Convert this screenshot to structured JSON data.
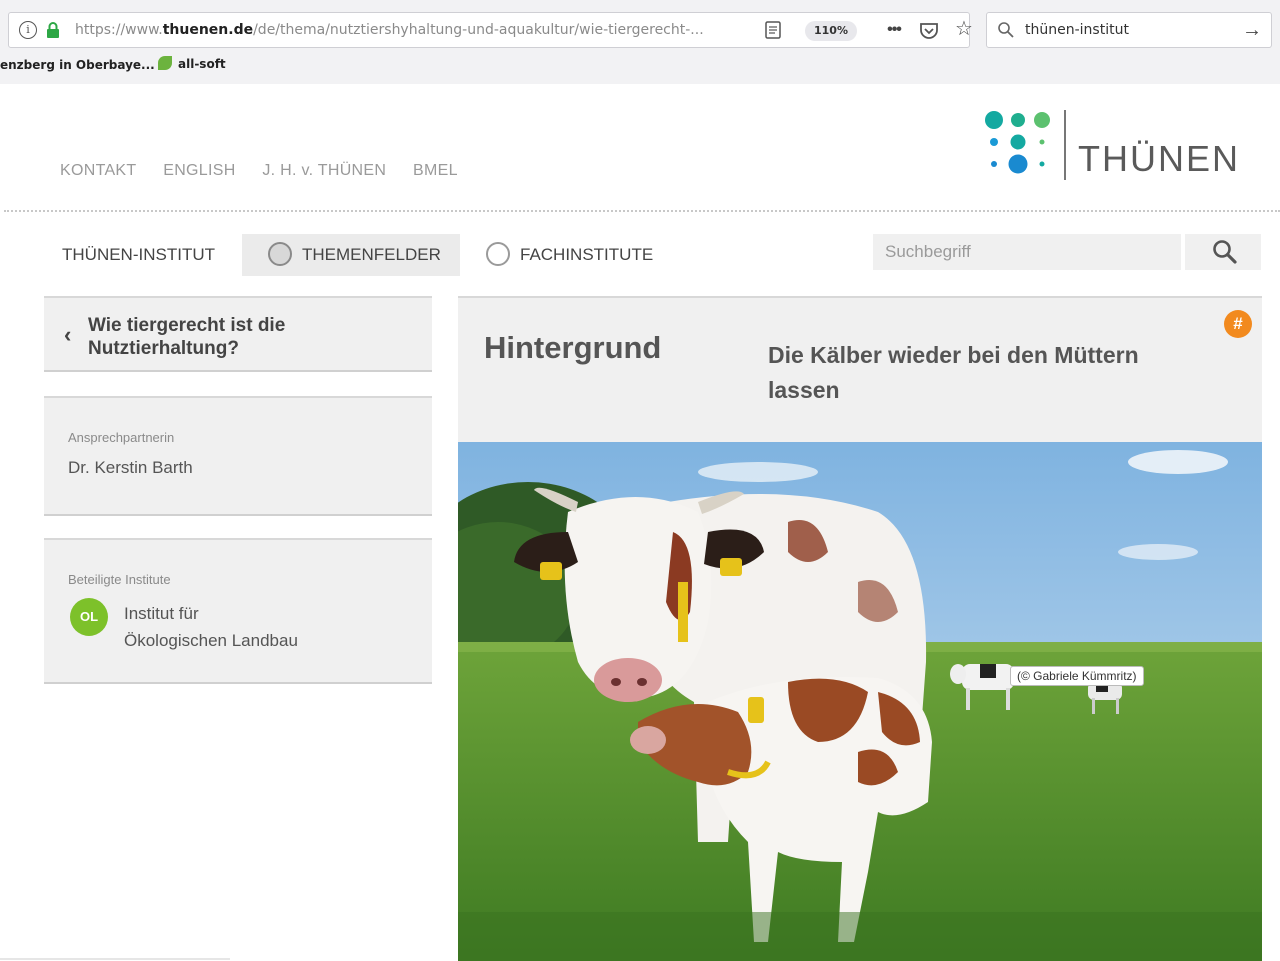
{
  "browser": {
    "url_prefix": "https://www.",
    "url_domain": "thuenen.de",
    "url_path": "/de/thema/nutztiershyhaltung-und-aquakultur/wie-tiergerecht-...",
    "zoom": "110%",
    "search_value": "thünen-institut",
    "bookmarks": [
      "enzberg in Oberbaye...",
      "all-soft"
    ]
  },
  "site": {
    "top_nav": [
      "KONTAKT",
      "ENGLISH",
      "J. H. v. THÜNEN",
      "BMEL"
    ],
    "logo_text": "THÜNEN",
    "main_nav": {
      "institut": "THÜNEN-INSTITUT",
      "themen": "THEMENFELDER",
      "fach": "FACHINSTITUTE"
    },
    "search_placeholder": "Suchbegriff"
  },
  "sidebar": {
    "back_title": "Wie tiergerecht ist die Nutztierhaltung?",
    "contact_label": "Ansprechpartnerin",
    "contact_name": "Dr. Kerstin Barth",
    "institutes_label": "Beteiligte Institute",
    "institute_badge": "OL",
    "institute_line1": "Institut für",
    "institute_line2": "Ökologischen Landbau"
  },
  "article": {
    "kicker": "Hintergrund",
    "headline": "Die Kälber wieder bei den Müttern lassen",
    "share_icon_glyph": "#",
    "photo_credit": "(© Gabriele Kümmritz)"
  },
  "colors": {
    "accent_orange": "#f28a1e",
    "institute_green": "#7dc12a",
    "logo_green": "#5cc16f",
    "logo_teal": "#14a9a1",
    "logo_blue": "#1a8ad0"
  }
}
